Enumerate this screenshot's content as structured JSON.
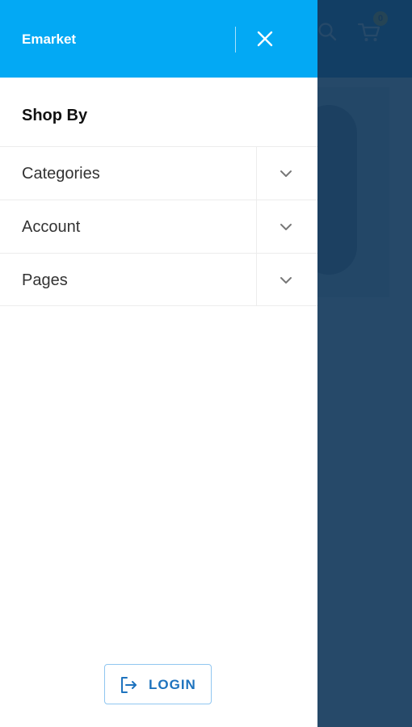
{
  "background_page": {
    "cart_count": "0",
    "colors": {
      "header": "#0a78b8",
      "overlay": "#133a5c",
      "cart_badge": "#f2b705"
    },
    "icons": [
      "search-icon",
      "cart-icon",
      "user-icon"
    ]
  },
  "drawer": {
    "title": "Emarket",
    "close_icon": "close-icon",
    "section_title": "Shop By",
    "menu_items": [
      {
        "label": "Categories",
        "icon": "chevron-down-icon"
      },
      {
        "label": "Account",
        "icon": "chevron-down-icon"
      },
      {
        "label": "Pages",
        "icon": "chevron-down-icon"
      }
    ],
    "login": {
      "label": "LOGIN",
      "icon": "login-icon"
    },
    "colors": {
      "header": "#03a9f4",
      "accent": "#1e73be",
      "text": "#333333"
    }
  }
}
